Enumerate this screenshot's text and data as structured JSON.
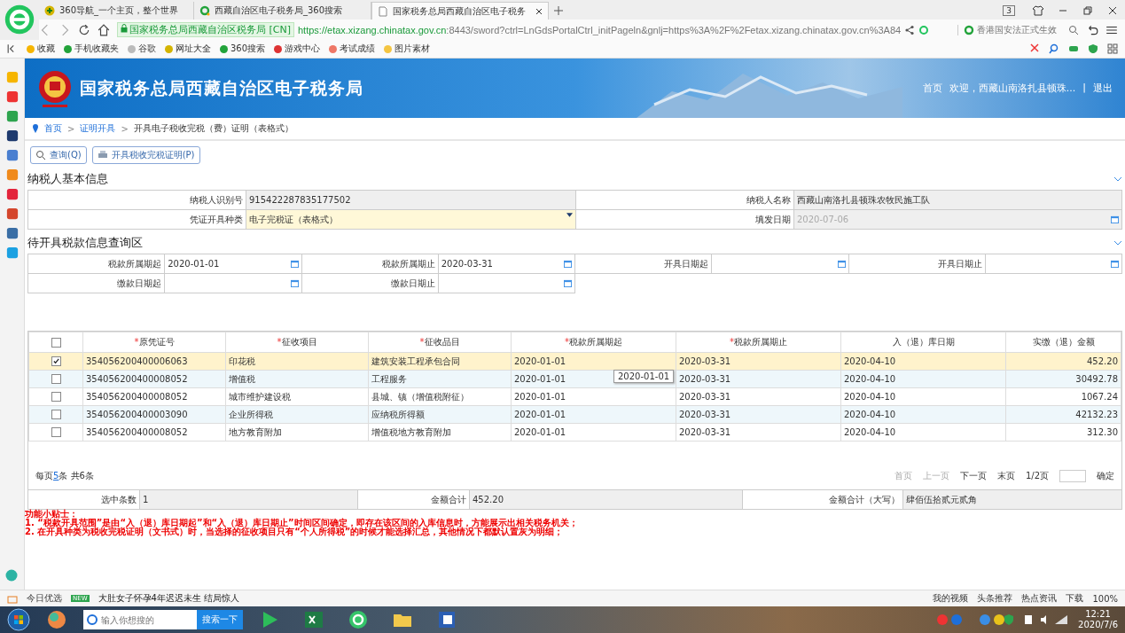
{
  "browser": {
    "tabs": [
      {
        "label": "360导航_一个主页，整个世界",
        "selected": false
      },
      {
        "label": "西藏自治区电子税务局_360搜索",
        "selected": false
      },
      {
        "label": "国家税务总局西藏自治区电子税务",
        "selected": true
      }
    ],
    "tab_count": "3",
    "security_label": "国家税务总局西藏自治区税务局 [CN]",
    "url_host": "https://etax.xizang.chinatax.gov.cn",
    "url_rest": ":8443/sword?ctrl=LnGdsPortalCtrl_initPageln&gnlj=https%3A%2F%2Fetax.xizang.chinatax.gov.cn%3A84",
    "search": {
      "placeholder": "香港国安法正式生效"
    },
    "bookmarks": [
      "收藏",
      "手机收藏夹",
      "谷歌",
      "网址大全",
      "360搜索",
      "游戏中心",
      "考试成绩",
      "图片素材"
    ]
  },
  "header": {
    "title": "国家税务总局西藏自治区电子税务局",
    "nav": [
      "首页",
      "欢迎，西藏山南洛扎县顿珠...",
      "|",
      "退出"
    ]
  },
  "breadcrumb": [
    {
      "kind": "link",
      "label": "首页"
    },
    {
      "kind": "separator",
      "label": ">"
    },
    {
      "kind": "link",
      "label": "证明开具"
    },
    {
      "kind": "separator",
      "label": ">"
    },
    {
      "kind": "current",
      "label": "开具电子税收完税（费）证明（表格式）"
    }
  ],
  "toolbar": [
    {
      "label": "查询(Q)",
      "kind": "query"
    },
    {
      "label": "开具税收完税证明(P)",
      "kind": "print"
    }
  ],
  "taxpayer": {
    "title": "纳税人基本信息",
    "rows": [
      [
        {
          "label": "纳税人识别号",
          "value": "915422287835177502",
          "kind": "readonly"
        },
        {
          "label": "纳税人名称",
          "value": "西藏山南洛扎县顿珠农牧民施工队",
          "kind": "readonly"
        }
      ],
      [
        {
          "label": "凭证开具种类",
          "value": "电子完税证（表格式）",
          "kind": "select"
        },
        {
          "label": "填发日期",
          "value": "2020-07-06",
          "kind": "disabled-date"
        }
      ]
    ]
  },
  "query": {
    "title": "待开具税款信息查询区",
    "rows": [
      [
        {
          "label": "税款所属期起",
          "value": "2020-01-01"
        },
        {
          "label": "税款所属期止",
          "value": "2020-03-31"
        },
        {
          "label": "开具日期起"
        },
        {
          "label": "开具日期止"
        }
      ],
      [
        {
          "label": "缴款日期起"
        },
        {
          "label": "缴款日期止"
        }
      ]
    ]
  },
  "grid": {
    "columns": [
      {
        "label": "原凭证号",
        "mark": "*"
      },
      {
        "label": "征收项目",
        "mark": "*"
      },
      {
        "label": "征收品目",
        "mark": "*"
      },
      {
        "label": "税款所属期起",
        "mark": "*"
      },
      {
        "label": "税款所属期止",
        "mark": "*"
      },
      {
        "label": "入（退）库日期"
      },
      {
        "label": "实缴（退）金额"
      }
    ],
    "header_checked": false,
    "rows": [
      {
        "checked": true,
        "selected": true,
        "cells": [
          "354056200400006063",
          "印花税",
          "建筑安装工程承包合同",
          "2020-01-01",
          "2020-03-31",
          "2020-04-10",
          "452.20"
        ]
      },
      {
        "checked": false,
        "selected": false,
        "cells": [
          "354056200400008052",
          "增值税",
          "工程服务",
          "2020-01-01",
          "2020-03-31",
          "2020-04-10",
          "30492.78"
        ]
      },
      {
        "checked": false,
        "selected": false,
        "cells": [
          "354056200400008052",
          "城市维护建设税",
          "县城、镇（增值税附征）",
          "2020-01-01",
          "2020-03-31",
          "2020-04-10",
          "1067.24"
        ]
      },
      {
        "checked": false,
        "selected": false,
        "cells": [
          "354056200400003090",
          "企业所得税",
          "应纳税所得额",
          "2020-01-01",
          "2020-03-31",
          "2020-04-10",
          "42132.23"
        ]
      },
      {
        "checked": false,
        "selected": false,
        "cells": [
          "354056200400008052",
          "地方教育附加",
          "增值税地方教育附加",
          "2020-01-01",
          "2020-03-31",
          "2020-04-10",
          "312.30"
        ]
      }
    ],
    "tooltip": "2020-01-01"
  },
  "pager": {
    "per_page_prefix": "每页",
    "per_page": "5",
    "per_page_suffix": "条 共6条",
    "links": [
      {
        "label": "首页",
        "disabled": true
      },
      {
        "label": "上一页",
        "disabled": true
      },
      {
        "label": "下一页",
        "disabled": false
      },
      {
        "label": "末页",
        "disabled": false
      }
    ],
    "page": "1/2页",
    "confirm": "确定"
  },
  "summary": [
    {
      "label": "选中条数",
      "value": "1"
    },
    {
      "label": "金额合计",
      "value": "452.20"
    },
    {
      "label": "金额合计（大写）",
      "value": "肆佰伍拾贰元贰角"
    }
  ],
  "tips": {
    "title": "功能小贴士：",
    "items": [
      "1.   “税款开具范围”是由“入（退）库日期起”和“入（退）库日期止”时间区间确定，即存在该区间的入库信息时，方能展示出相关税务机关；",
      "2.      在开具种类为税收完税证明（文书式）时，当选择的征收项目只有“个人所得税”的时候才能选择汇总，其他情况下都默认置灰为明细；"
    ]
  },
  "status_bar": {
    "left": "今日优选",
    "badge": "NEW",
    "headline": "大肚女子怀孕4年迟迟未生 结局惊人",
    "right": [
      "我的视频",
      "头条推荐",
      "热点资讯",
      "下载"
    ],
    "zoom": "100%"
  },
  "taskbar": {
    "search": {
      "placeholder": "输入你想搜的",
      "button": "搜索一下"
    },
    "time": "12:21",
    "date": "2020/7/6"
  }
}
